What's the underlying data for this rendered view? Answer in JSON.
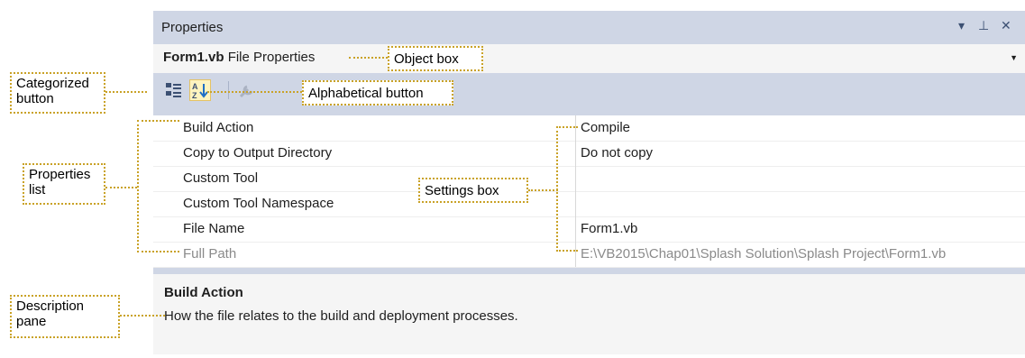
{
  "window": {
    "title": "Properties",
    "controls": {
      "dropdown": "▾",
      "pin": "⊥",
      "close": "✕"
    }
  },
  "object_box": {
    "name": "Form1.vb",
    "type": "File Properties"
  },
  "toolbar": {
    "categorized_icon": "categorized-icon",
    "alphabetical_icon": "alphabetical-icon",
    "property_pages_icon": "wrench-icon"
  },
  "properties": [
    {
      "name": "Build Action",
      "value": "Compile"
    },
    {
      "name": "Copy to Output Directory",
      "value": "Do not copy"
    },
    {
      "name": "Custom Tool",
      "value": ""
    },
    {
      "name": "Custom Tool Namespace",
      "value": ""
    },
    {
      "name": "File Name",
      "value": "Form1.vb"
    },
    {
      "name": "Full Path",
      "value": "E:\\VB2015\\Chap01\\Splash Solution\\Splash Project\\Form1.vb"
    }
  ],
  "description": {
    "title": "Build Action",
    "text": "How the file relates to the build and deployment processes."
  },
  "callouts": {
    "object_box": "Object box",
    "alphabetical": "Alphabetical button",
    "categorized_line1": "Categorized",
    "categorized_line2": "button",
    "properties_line1": "Properties",
    "properties_line2": "list",
    "settings_box": "Settings box",
    "description_line1": "Description",
    "description_line2": "pane"
  },
  "colors": {
    "window_chrome": "#cfd6e5",
    "callout_border": "#c9a227",
    "selected_button": "#fdf4bf"
  }
}
